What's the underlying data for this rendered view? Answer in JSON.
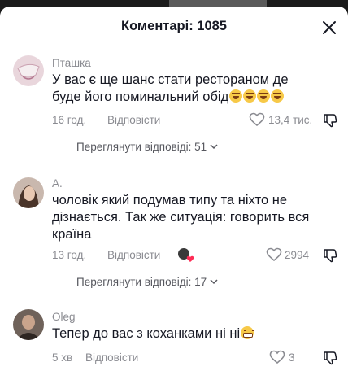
{
  "header": {
    "title": "Коментарі: 1085"
  },
  "comments": [
    {
      "author": "Пташка",
      "text": "У вас є ще шанс стати рестораном де буде його поминальний обід",
      "time": "16 год.",
      "reply_label": "Відповісти",
      "likes": "13,4 тис.",
      "view_replies": "Переглянути відповіді: 51",
      "avatar_color": "#e9d6dc"
    },
    {
      "author": "A.",
      "text": "чоловік який подумав типу та ніхто не дізнається. Так же ситуація: говорить вся країна",
      "time": "13 год.",
      "reply_label": "Відповісти",
      "likes": "2994",
      "view_replies": "Переглянути відповіді: 17",
      "avatar_color": "#8b6f62"
    },
    {
      "author": "Oleg",
      "text": "Тепер до вас з коханками ні ні",
      "time": "5 хв",
      "reply_label": "Відповісти",
      "likes": "3",
      "avatar_color": "#5a4c44"
    }
  ],
  "icons": {
    "close": "close-icon",
    "heart": "heart-icon",
    "dislike": "thumbs-down-icon",
    "chevron": "chevron-down-icon",
    "laugh_emoji": "rolling-laughing-emoji",
    "grin_emoji": "grinning-emoji"
  },
  "colors": {
    "muted": "#8a8b91",
    "text": "#161823",
    "creator_heart": "#fe2c55"
  }
}
